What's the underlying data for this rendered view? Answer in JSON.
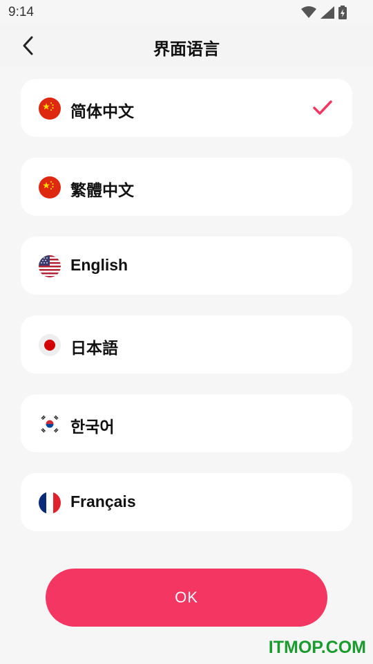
{
  "status": {
    "time": "9:14"
  },
  "header": {
    "title": "界面语言"
  },
  "languages": [
    {
      "label": "简体中文",
      "flag": "china-flag-icon",
      "selected": true
    },
    {
      "label": "繁體中文",
      "flag": "china-flag-icon",
      "selected": false
    },
    {
      "label": "English",
      "flag": "us-flag-icon",
      "selected": false
    },
    {
      "label": "日本語",
      "flag": "japan-flag-icon",
      "selected": false
    },
    {
      "label": "한국어",
      "flag": "korea-flag-icon",
      "selected": false
    },
    {
      "label": "Français",
      "flag": "france-flag-icon",
      "selected": false
    }
  ],
  "ok_button": {
    "label": "OK"
  },
  "watermark": {
    "text": "ITMOP.COM"
  },
  "colors": {
    "accent": "#f43663",
    "background": "#f6f6f6",
    "card": "#ffffff",
    "watermark": "#1a9b2e"
  }
}
